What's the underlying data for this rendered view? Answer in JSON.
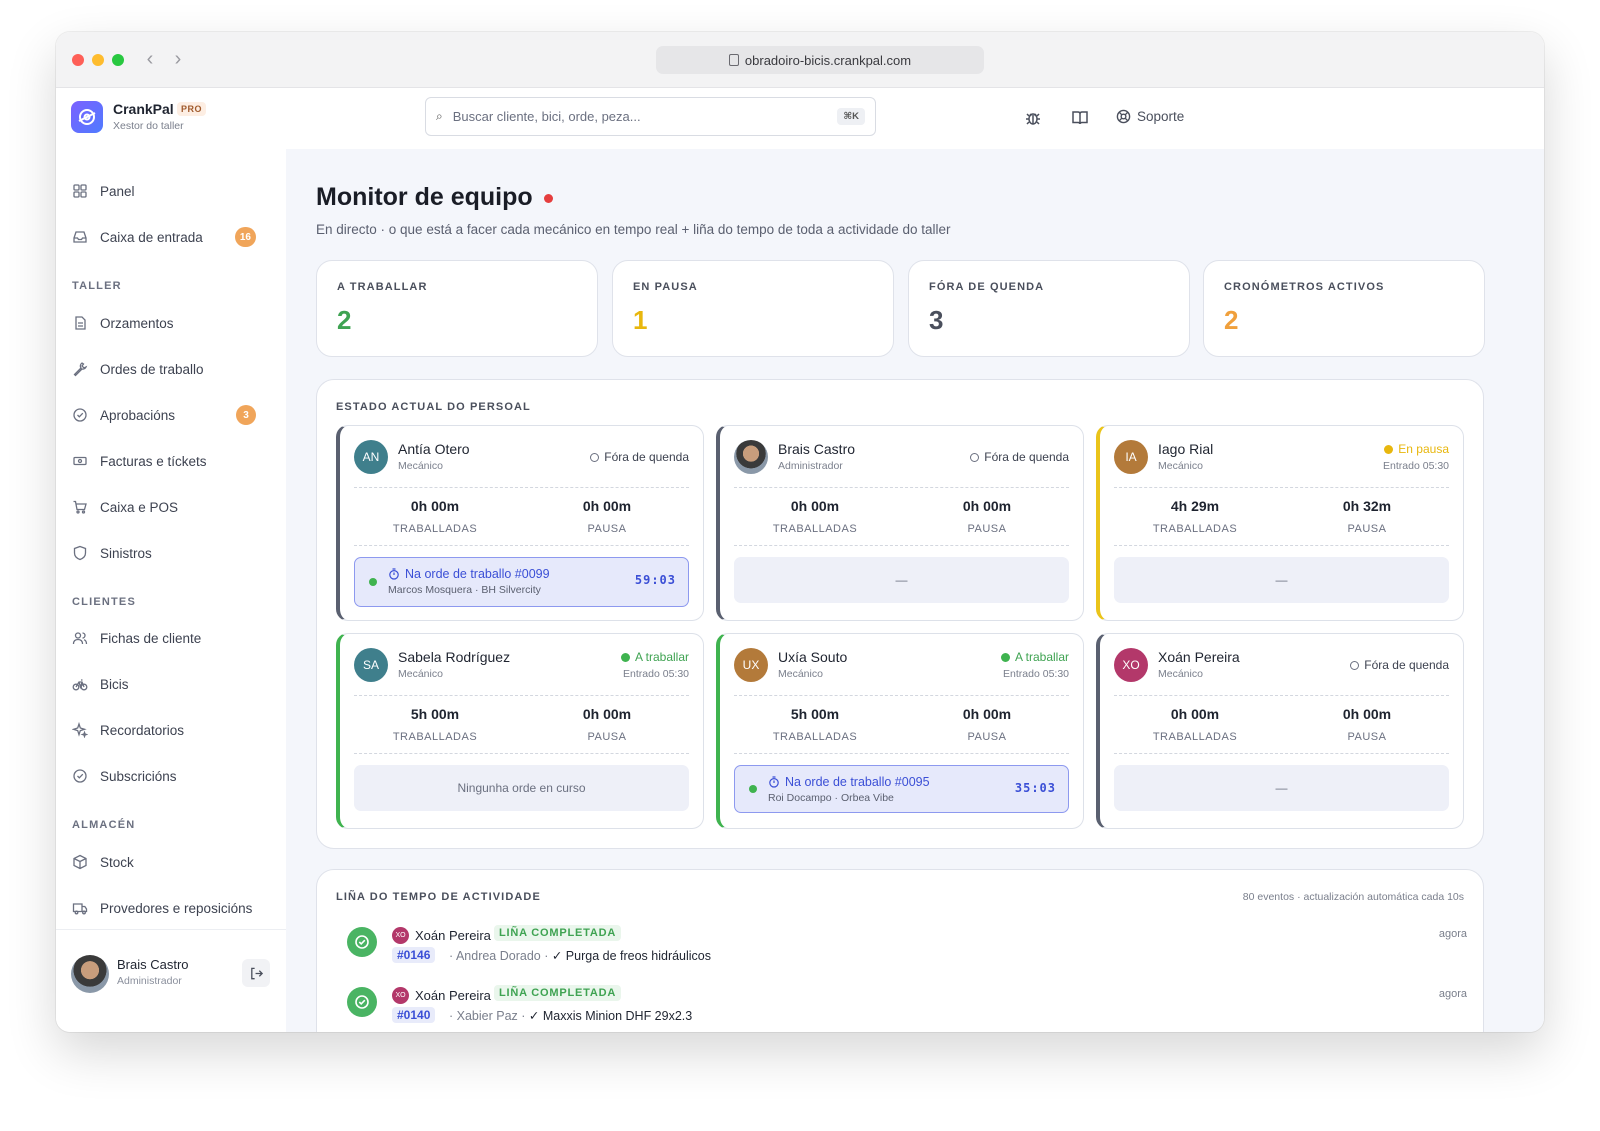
{
  "browser": {
    "url": "obradoiro-bicis.crankpal.com"
  },
  "brand": {
    "name": "CrankPal",
    "badge": "PRO",
    "subtitle": "Xestor do taller"
  },
  "search": {
    "placeholder": "Buscar cliente, bici, orde, peza...",
    "shortcut": "⌘K"
  },
  "header": {
    "support_label": "Soporte"
  },
  "sidebar": {
    "items": [
      {
        "label": "Panel",
        "icon": "grid-icon"
      },
      {
        "label": "Caixa de entrada",
        "icon": "inbox-icon",
        "badge": "16"
      }
    ],
    "sections": [
      {
        "label": "TALLER",
        "items": [
          {
            "label": "Orzamentos",
            "icon": "document-icon"
          },
          {
            "label": "Ordes de traballo",
            "icon": "wrench-icon"
          },
          {
            "label": "Aprobacións",
            "icon": "check-circle-icon",
            "badge": "3"
          },
          {
            "label": "Facturas e tíckets",
            "icon": "ticket-icon"
          },
          {
            "label": "Caixa e POS",
            "icon": "cart-icon"
          },
          {
            "label": "Sinistros",
            "icon": "shield-icon"
          }
        ]
      },
      {
        "label": "CLIENTES",
        "items": [
          {
            "label": "Fichas de cliente",
            "icon": "users-icon"
          },
          {
            "label": "Bicis",
            "icon": "bike-icon"
          },
          {
            "label": "Recordatorios",
            "icon": "sparkle-icon"
          },
          {
            "label": "Subscricións",
            "icon": "check-circle-icon"
          }
        ]
      },
      {
        "label": "ALMACÉN",
        "items": [
          {
            "label": "Stock",
            "icon": "box-icon"
          },
          {
            "label": "Provedores e reposicións",
            "icon": "truck-icon"
          }
        ]
      }
    ],
    "user": {
      "name": "Brais Castro",
      "role": "Administrador"
    }
  },
  "page": {
    "title": "Monitor de equipo",
    "subtitle": "En directo · o que está a facer cada mecánico en tempo real + liña do tempo de toda a actividade do taller"
  },
  "stats": [
    {
      "label": "A TRABALLAR",
      "value": "2",
      "color": "#3fa352"
    },
    {
      "label": "EN PAUSA",
      "value": "1",
      "color": "#e8b70e"
    },
    {
      "label": "FÓRA DE QUENDA",
      "value": "3",
      "color": "#4a4f5c"
    },
    {
      "label": "CRONÓMETROS ACTIVOS",
      "value": "2",
      "color": "#f0a03c"
    }
  ],
  "staff_panel": {
    "title": "ESTADO ACTUAL DO PERSOAL",
    "worked_label": "TRABALLADAS",
    "pause_label": "PAUSA",
    "cards": [
      {
        "initials": "AN",
        "name": "Antía Otero",
        "role": "Mecánico",
        "status": "Fóra de quenda",
        "worked": "0h 00m",
        "pause": "0h 00m",
        "job_title": "Na orde de traballo #0099",
        "job_sub": "Marcos Mosquera · BH Silvercity",
        "job_time": "59:03"
      },
      {
        "initials": "",
        "name": "Brais Castro",
        "role": "Administrador",
        "status": "Fóra de quenda",
        "worked": "0h 00m",
        "pause": "0h 00m",
        "job_empty": "—"
      },
      {
        "initials": "IA",
        "name": "Iago Rial",
        "role": "Mecánico",
        "status": "En pausa",
        "entry": "Entrado 05:30",
        "worked": "4h 29m",
        "pause": "0h 32m",
        "job_empty": "—"
      },
      {
        "initials": "SA",
        "name": "Sabela Rodríguez",
        "role": "Mecánico",
        "status": "A traballar",
        "entry": "Entrado 05:30",
        "worked": "5h 00m",
        "pause": "0h 00m",
        "job_empty": "Ningunha orde en curso"
      },
      {
        "initials": "UX",
        "name": "Uxía Souto",
        "role": "Mecánico",
        "status": "A traballar",
        "entry": "Entrado 05:30",
        "worked": "5h 00m",
        "pause": "0h 00m",
        "job_title": "Na orde de traballo #0095",
        "job_sub": "Roi Docampo · Orbea Vibe",
        "job_time": "35:03"
      },
      {
        "initials": "XO",
        "name": "Xoán Pereira",
        "role": "Mecánico",
        "status": "Fóra de quenda",
        "worked": "0h 00m",
        "pause": "0h 00m",
        "job_empty": "—"
      }
    ]
  },
  "timeline": {
    "title": "LIÑA DO TEMPO DE ACTIVIDADE",
    "meta": "80 eventos · actualización automática cada 10s",
    "events": [
      {
        "initials": "XO",
        "name": "Xoán Pereira",
        "tag": "LIÑA COMPLETADA",
        "order": "#0146",
        "customer": "Andrea Dorado",
        "detail": "✓ Purga de freos hidráulicos",
        "time": "agora"
      },
      {
        "initials": "XO",
        "name": "Xoán Pereira",
        "tag": "LIÑA COMPLETADA",
        "order": "#0140",
        "customer": "Xabier Paz",
        "detail": "✓ Maxxis Minion DHF 29x2.3",
        "time": "agora"
      }
    ]
  }
}
